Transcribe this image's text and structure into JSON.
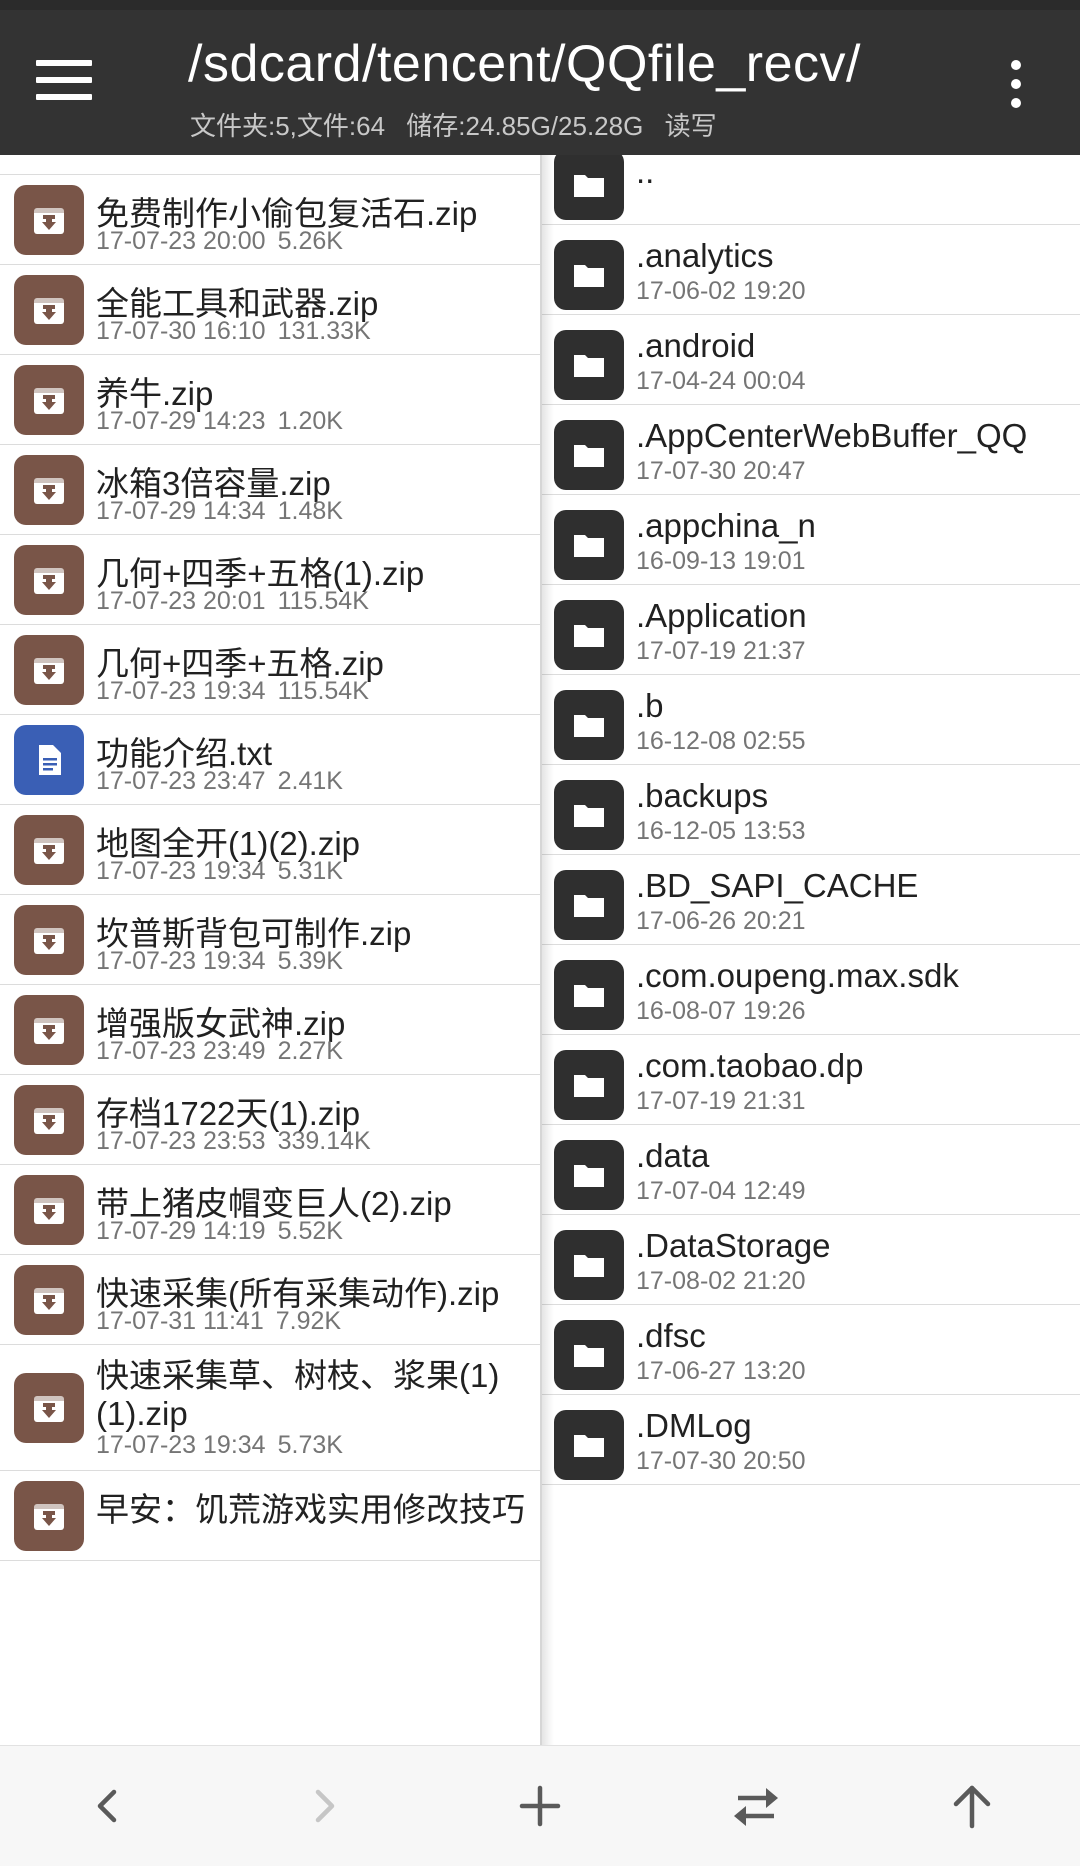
{
  "header": {
    "path": "/sdcard/tencent/QQfile_recv/",
    "folders_label": "文件夹:5,文件:64",
    "storage_label": "储存:24.85G/25.28G",
    "mode_label": "读写"
  },
  "left_files": [
    {
      "name": "免费制作小偷包复活石.zip",
      "date": "17-07-23 20:00",
      "size": "5.26K",
      "type": "zip"
    },
    {
      "name": "全能工具和武器.zip",
      "date": "17-07-30 16:10",
      "size": "131.33K",
      "type": "zip"
    },
    {
      "name": "养牛.zip",
      "date": "17-07-29 14:23",
      "size": "1.20K",
      "type": "zip"
    },
    {
      "name": "冰箱3倍容量.zip",
      "date": "17-07-29 14:34",
      "size": "1.48K",
      "type": "zip"
    },
    {
      "name": "几何+四季+五格(1).zip",
      "date": "17-07-23 20:01",
      "size": "115.54K",
      "type": "zip"
    },
    {
      "name": "几何+四季+五格.zip",
      "date": "17-07-23 19:34",
      "size": "115.54K",
      "type": "zip"
    },
    {
      "name": "功能介绍.txt",
      "date": "17-07-23 23:47",
      "size": "2.41K",
      "type": "txt"
    },
    {
      "name": "地图全开(1)(2).zip",
      "date": "17-07-23 19:34",
      "size": "5.31K",
      "type": "zip"
    },
    {
      "name": "坎普斯背包可制作.zip",
      "date": "17-07-23 19:34",
      "size": "5.39K",
      "type": "zip"
    },
    {
      "name": "增强版女武神.zip",
      "date": "17-07-23 23:49",
      "size": "2.27K",
      "type": "zip"
    },
    {
      "name": "存档1722天(1).zip",
      "date": "17-07-23 23:53",
      "size": "339.14K",
      "type": "zip"
    },
    {
      "name": "带上猪皮帽变巨人(2).zip",
      "date": "17-07-29 14:19",
      "size": "5.52K",
      "type": "zip"
    },
    {
      "name": "快速采集(所有采集动作).zip",
      "date": "17-07-31 11:41",
      "size": "7.92K",
      "type": "zip"
    },
    {
      "name": "快速采集草、树枝、浆果(1)(1).zip",
      "date": "17-07-23 19:34",
      "size": "5.73K",
      "type": "zip"
    },
    {
      "name": "早安：饥荒游戏实用修改技巧",
      "date": "",
      "size": "",
      "type": "zip"
    }
  ],
  "right_folders": [
    {
      "name": "..",
      "date": ""
    },
    {
      "name": ".analytics",
      "date": "17-06-02 19:20"
    },
    {
      "name": ".android",
      "date": "17-04-24 00:04"
    },
    {
      "name": ".AppCenterWebBuffer_QQ",
      "date": "17-07-30 20:47"
    },
    {
      "name": ".appchina_n",
      "date": "16-09-13 19:01"
    },
    {
      "name": ".Application",
      "date": "17-07-19 21:37"
    },
    {
      "name": ".b",
      "date": "16-12-08 02:55"
    },
    {
      "name": ".backups",
      "date": "16-12-05 13:53"
    },
    {
      "name": ".BD_SAPI_CACHE",
      "date": "17-06-26 20:21"
    },
    {
      "name": ".com.oupeng.max.sdk",
      "date": "16-08-07 19:26"
    },
    {
      "name": ".com.taobao.dp",
      "date": "17-07-19 21:31"
    },
    {
      "name": ".data",
      "date": "17-07-04 12:49"
    },
    {
      "name": ".DataStorage",
      "date": "17-08-02 21:20"
    },
    {
      "name": ".dfsc",
      "date": "17-06-27 13:20"
    },
    {
      "name": ".DMLog",
      "date": "17-07-30 20:50"
    }
  ],
  "bottom_bar": [
    "back-icon",
    "forward-icon",
    "add-icon",
    "swap-icon",
    "up-icon"
  ],
  "colors": {
    "appbar": "#333333",
    "zip_icon": "#795548",
    "txt_icon": "#3a5fb5",
    "folder_icon": "#2f2f2f"
  }
}
